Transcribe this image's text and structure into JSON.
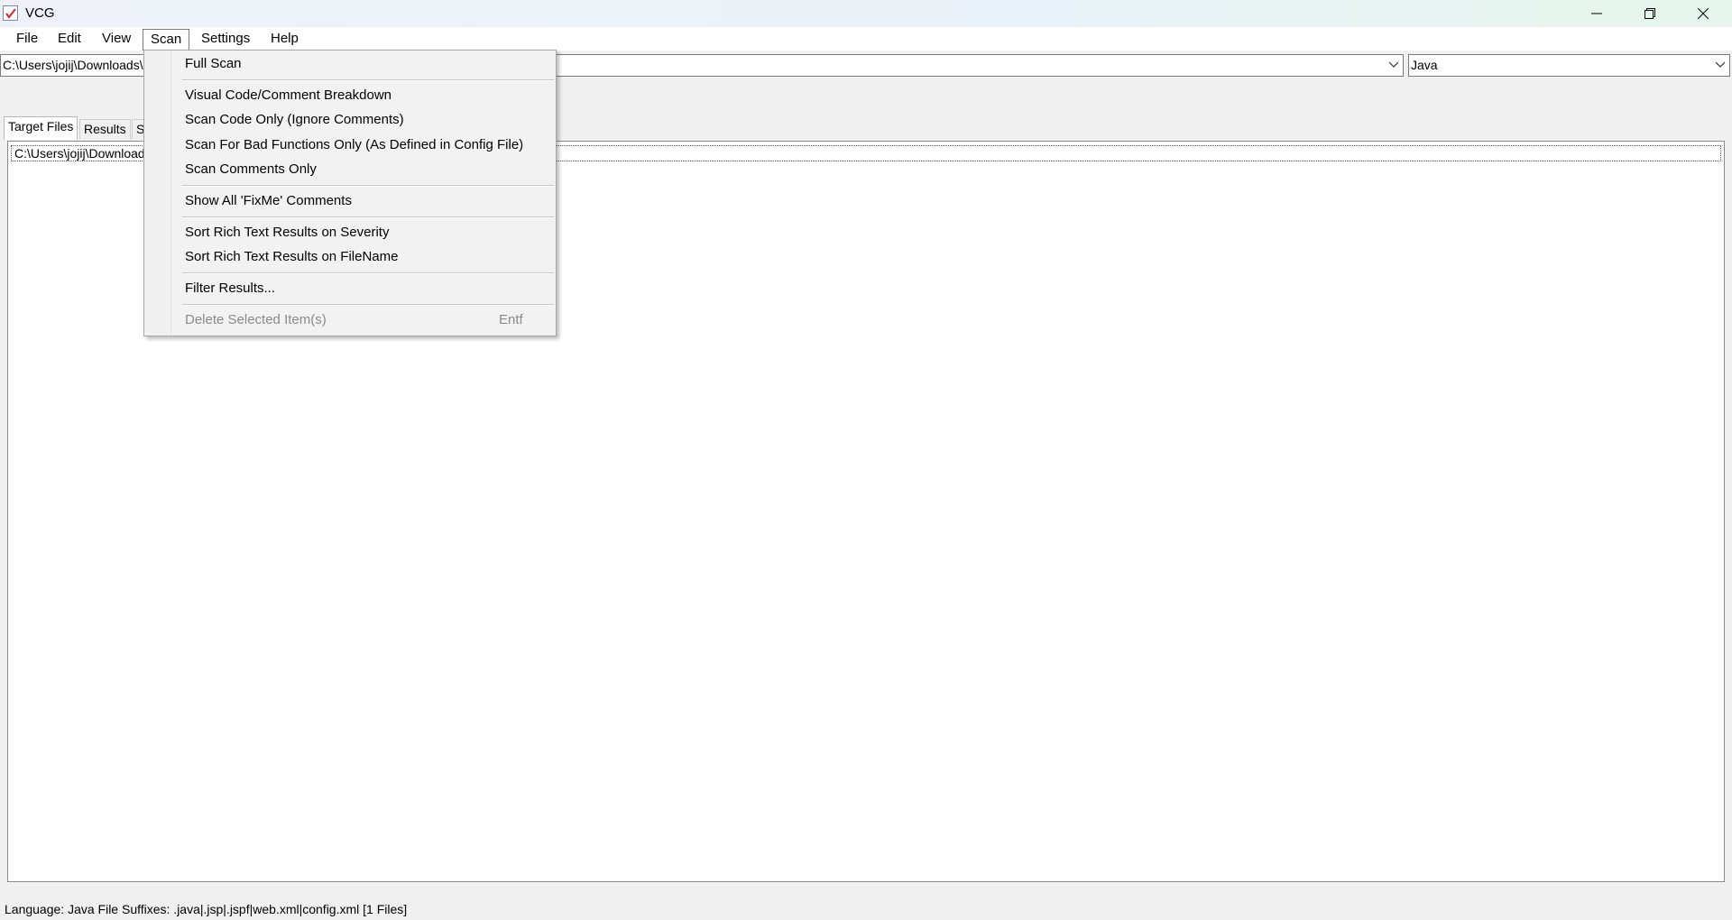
{
  "window": {
    "title": "VCG",
    "accent_color": "#cc2f3a"
  },
  "menubar": {
    "items": [
      {
        "label": "File"
      },
      {
        "label": "Edit"
      },
      {
        "label": "View"
      },
      {
        "label": "Scan"
      },
      {
        "label": "Settings"
      },
      {
        "label": "Help"
      }
    ],
    "active": "Scan"
  },
  "path_combo": {
    "value": "C:\\Users\\jojij\\Downloads\\"
  },
  "language_combo": {
    "value": "Java"
  },
  "tabs": [
    {
      "label": "Target Files",
      "selected": true
    },
    {
      "label": "Results",
      "selected": false
    },
    {
      "label": "S",
      "selected": false
    }
  ],
  "content": {
    "file_row": "C:\\Users\\jojij\\Downloads"
  },
  "scan_menu": {
    "items": [
      {
        "label": "Full Scan",
        "enabled": true
      },
      {
        "label": "Visual Code/Comment Breakdown",
        "enabled": true
      },
      {
        "label": "Scan Code Only (Ignore Comments)",
        "enabled": true
      },
      {
        "label": "Scan For Bad Functions Only (As Defined in Config File)",
        "enabled": true
      },
      {
        "label": "Scan Comments Only",
        "enabled": true
      },
      {
        "label": "Show All 'FixMe' Comments",
        "enabled": true
      },
      {
        "label": "Sort Rich Text Results on Severity",
        "enabled": true
      },
      {
        "label": "Sort Rich Text Results on FileName",
        "enabled": true
      },
      {
        "label": "Filter Results...",
        "enabled": true
      },
      {
        "label": "Delete Selected Item(s)",
        "enabled": false,
        "shortcut": "Entf"
      }
    ]
  },
  "statusbar": {
    "text": "Language: Java   File Suffixes: .java|.jsp|.jspf|web.xml|config.xml   [1 Files]"
  }
}
